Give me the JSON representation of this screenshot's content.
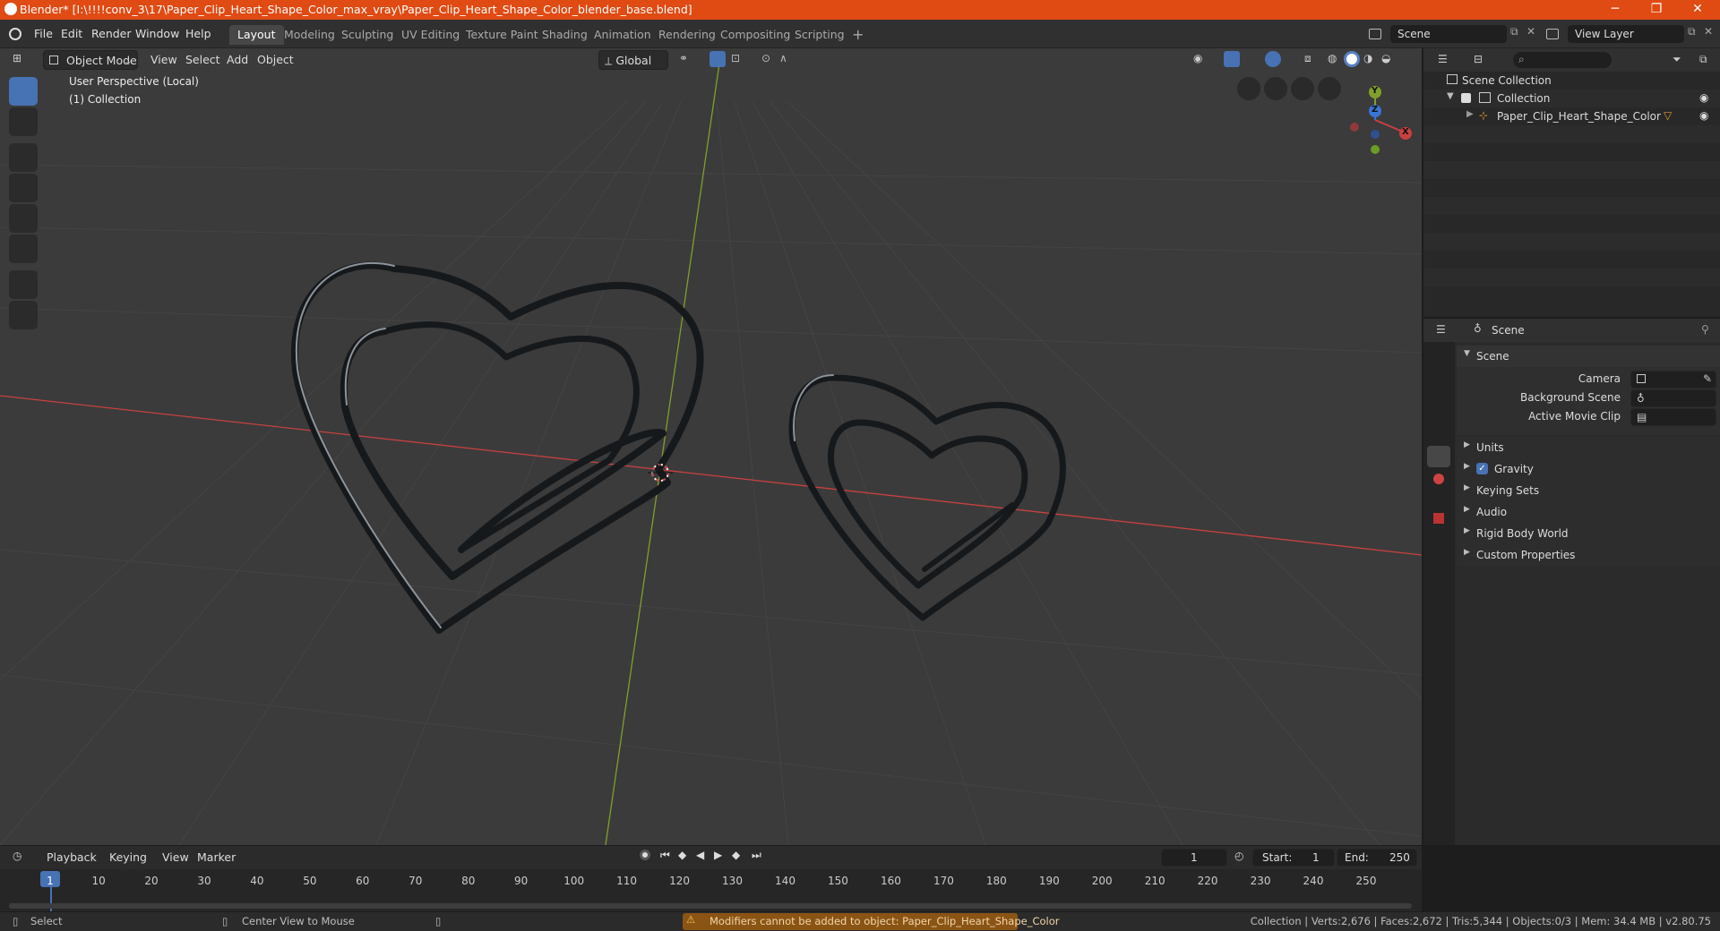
{
  "titlebar": {
    "title": "Blender* [I:\\!!!!conv_3\\17\\Paper_Clip_Heart_Shape_Color_max_vray\\Paper_Clip_Heart_Shape_Color_blender_base.blend]",
    "minimize": "─",
    "maximize": "❐",
    "close": "✕"
  },
  "menubar": {
    "menus": [
      "File",
      "Edit",
      "Render",
      "Window",
      "Help"
    ],
    "workspaces": [
      "Layout",
      "Modeling",
      "Sculpting",
      "UV Editing",
      "Texture Paint",
      "Shading",
      "Animation",
      "Rendering",
      "Compositing",
      "Scripting"
    ],
    "add_workspace": "+",
    "scene_label": "Scene",
    "view_layer_label": "View Layer"
  },
  "viewport": {
    "mode": "Object Mode",
    "menus": [
      "View",
      "Select",
      "Add",
      "Object"
    ],
    "orientation": "Global",
    "overlay_line1": "User Perspective (Local)",
    "overlay_line2": "(1) Collection",
    "gizmo": {
      "x": "X",
      "y": "Y",
      "z": "Z"
    },
    "colors": {
      "x_axis": "#c8413f",
      "y_axis": "#7fa02b",
      "bg": "#3b3b3b"
    },
    "tools": [
      "select-box-icon",
      "cursor-icon",
      "move-icon",
      "rotate-icon",
      "scale-icon",
      "transform-icon",
      "annotate-icon",
      "measure-icon"
    ]
  },
  "outliner": {
    "root": "Scene Collection",
    "collection": "Collection",
    "object": "Paper_Clip_Heart_Shape_Color"
  },
  "properties": {
    "header": "Scene",
    "panel": "Scene",
    "fields": [
      {
        "label": "Camera",
        "value": ""
      },
      {
        "label": "Background Scene",
        "value": ""
      },
      {
        "label": "Active Movie Clip",
        "value": ""
      }
    ],
    "subpanels": [
      "Units",
      "Gravity",
      "Keying Sets",
      "Audio",
      "Rigid Body World",
      "Custom Properties"
    ]
  },
  "timeline": {
    "menus": [
      "Playback",
      "Keying",
      "View",
      "Marker"
    ],
    "current_frame": "1",
    "start_label": "Start:",
    "start": "1",
    "end_label": "End:",
    "end": "250",
    "frame_ticks": [
      "1",
      "10",
      "20",
      "30",
      "40",
      "50",
      "60",
      "70",
      "80",
      "90",
      "100",
      "110",
      "120",
      "130",
      "140",
      "150",
      "160",
      "170",
      "180",
      "190",
      "200",
      "210",
      "220",
      "230",
      "240",
      "250"
    ]
  },
  "statusbar": {
    "select": "Select",
    "center_view": "Center View to Mouse",
    "warning": "Modifiers cannot be added to object: Paper_Clip_Heart_Shape_Color",
    "stats": "Collection | Verts:2,676 | Faces:2,672 | Tris:5,344 | Objects:0/3 | Mem: 34.4 MB | v2.80.75"
  }
}
